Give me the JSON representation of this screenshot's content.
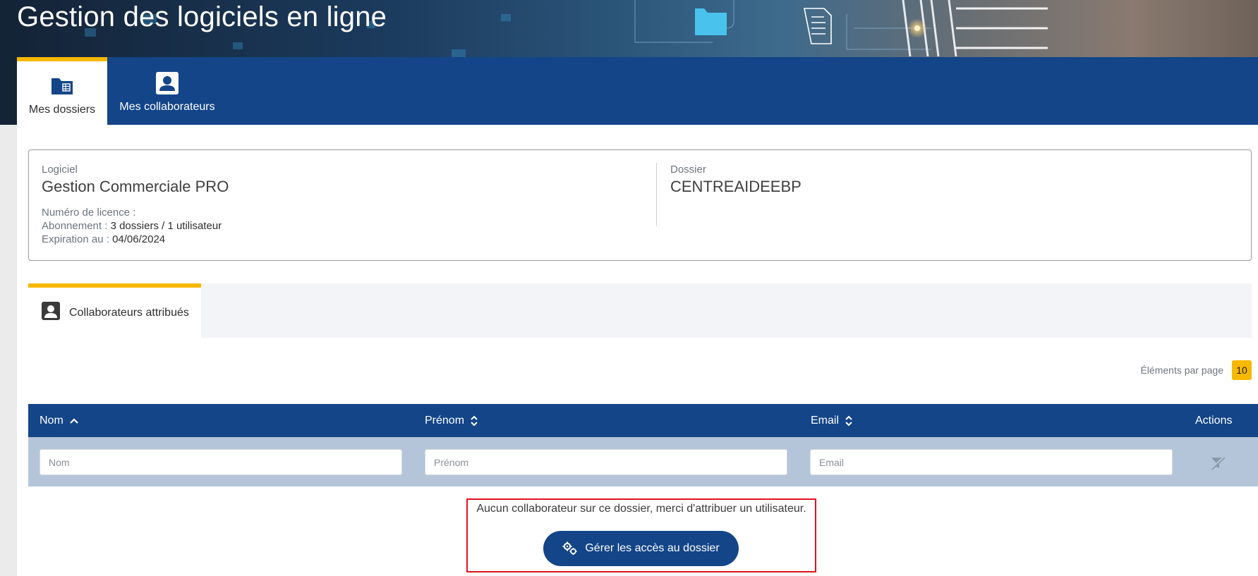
{
  "app": {
    "title": "Gestion des logiciels en ligne"
  },
  "colors": {
    "primary": "#134588",
    "accent": "#f7b800",
    "highlight": "#e0141e"
  },
  "nav": {
    "tabs": [
      {
        "label": "Mes dossiers",
        "icon": "folder-icon",
        "active": true
      },
      {
        "label": "Mes collaborateurs",
        "icon": "person-icon",
        "active": false
      }
    ]
  },
  "info": {
    "software_label": "Logiciel",
    "software_value": "Gestion Commerciale PRO",
    "license_label": "Numéro de licence :",
    "license_value": "",
    "subscription_label": "Abonnement :",
    "subscription_value": "3 dossiers / 1 utilisateur",
    "expiration_label": "Expiration au :",
    "expiration_value": "04/06/2024",
    "folder_label": "Dossier",
    "folder_value": "CENTREAIDEEBP"
  },
  "subtabs": [
    {
      "label": "Collaborateurs attribués",
      "icon": "person-icon",
      "active": true
    }
  ],
  "pagination": {
    "label": "Éléments par page",
    "value": "10"
  },
  "table": {
    "columns": [
      {
        "label": "Nom",
        "sort": "ascending"
      },
      {
        "label": "Prénom",
        "sort": "none"
      },
      {
        "label": "Email",
        "sort": "none"
      },
      {
        "label": "Actions",
        "sort": ""
      }
    ],
    "filters": {
      "nom_placeholder": "Nom",
      "prenom_placeholder": "Prénom",
      "email_placeholder": "Email"
    },
    "empty_message": "Aucun collaborateur sur ce dossier, merci d'attribuer un utilisateur.",
    "manage_button": "Gérer les accès au dossier"
  }
}
